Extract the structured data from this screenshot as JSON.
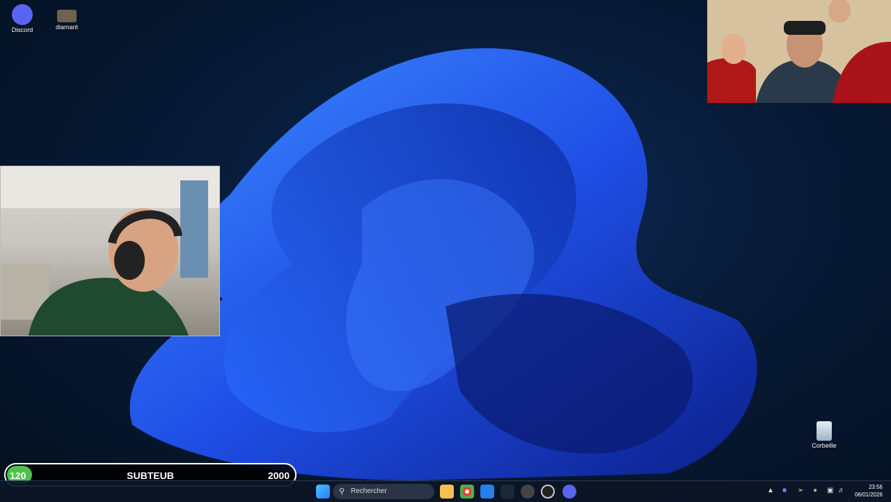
{
  "desktop": {
    "icons": [
      {
        "label": "Discord",
        "icon": "discord-icon",
        "color": "#5865F2"
      },
      {
        "label": "diamant",
        "icon": "diamond-icon",
        "color": "#8a7a5a"
      }
    ],
    "recycle_bin": {
      "label": "Corbeille",
      "icon": "recycle-bin-icon"
    }
  },
  "sub_goal": {
    "current": "120",
    "label": "SUBTEUB",
    "goal": "2000",
    "progress_fraction": 0.06,
    "fill_color": "#4cc24a"
  },
  "taskbar": {
    "search_placeholder": "Rechercher",
    "apps": [
      "windows-start-icon",
      "file-explorer-icon",
      "chrome-icon",
      "photos-icon",
      "steam-icon",
      "app-icon",
      "obs-icon",
      "discord-icon"
    ],
    "time": "23:56",
    "date": "06/01/2026"
  }
}
